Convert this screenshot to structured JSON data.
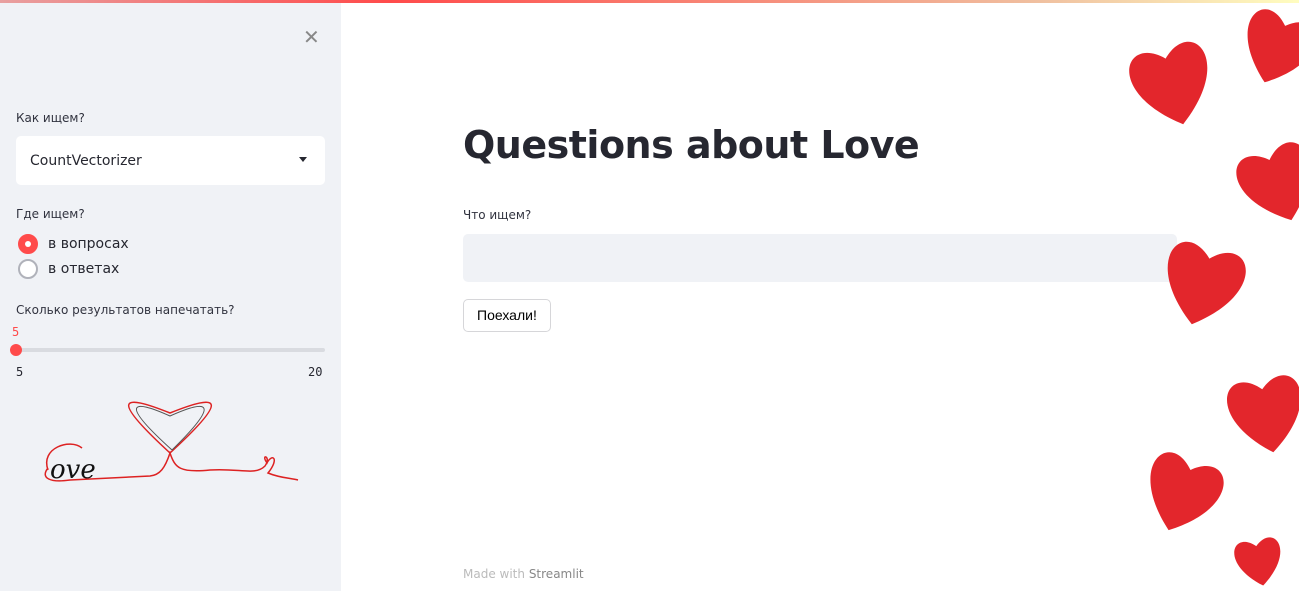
{
  "sidebar": {
    "close_icon": "close-icon",
    "method_label": "Как ищем?",
    "method_value": "CountVectorizer",
    "where_label": "Где ищем?",
    "where_options": [
      "в вопросах",
      "в ответах"
    ],
    "where_selected": 0,
    "count_label": "Сколько результатов напечатать?",
    "count_value": "5",
    "count_min": "5",
    "count_max": "20",
    "logo_text": "Love"
  },
  "main": {
    "title": "Questions about Love",
    "query_label": "Что ищем?",
    "query_value": "",
    "button_label": "Поехали!",
    "footer_prefix": "Made with",
    "footer_brand": "Streamlit",
    "menu_icon": "hamburger-menu-icon"
  },
  "colors": {
    "accent": "#ff4b4b",
    "sidebar_bg": "#f0f2f6",
    "heart": "#e3262c"
  }
}
